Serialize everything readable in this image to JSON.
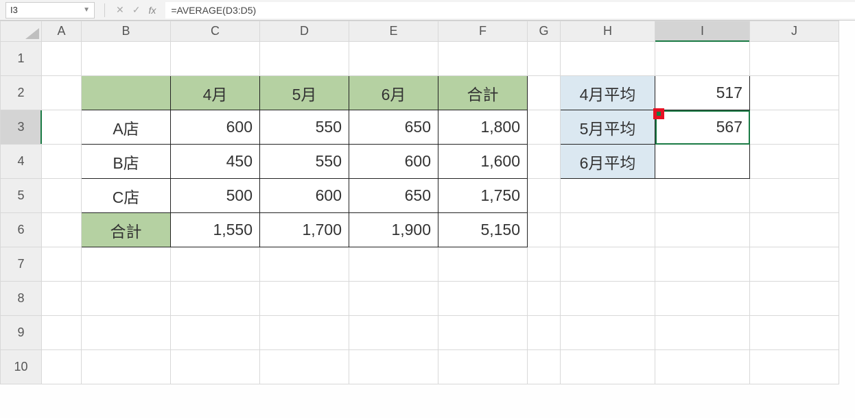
{
  "formula_bar": {
    "name_box": "I3",
    "cancel_icon": "✕",
    "confirm_icon": "✓",
    "fx_label": "fx",
    "formula": "=AVERAGE(D3:D5)"
  },
  "columns": [
    "A",
    "B",
    "C",
    "D",
    "E",
    "F",
    "G",
    "H",
    "I",
    "J"
  ],
  "rows": [
    "1",
    "2",
    "3",
    "4",
    "5",
    "6",
    "7",
    "8",
    "9",
    "10"
  ],
  "active_cell": "I3",
  "table1": {
    "headers": [
      "",
      "4月",
      "5月",
      "6月",
      "合計"
    ],
    "rows": [
      {
        "label": "A店",
        "vals": [
          "600",
          "550",
          "650",
          "1,800"
        ]
      },
      {
        "label": "B店",
        "vals": [
          "450",
          "550",
          "600",
          "1,600"
        ]
      },
      {
        "label": "C店",
        "vals": [
          "500",
          "600",
          "650",
          "1,750"
        ]
      },
      {
        "label": "合計",
        "vals": [
          "1,550",
          "1,700",
          "1,900",
          "5,150"
        ]
      }
    ]
  },
  "table2": {
    "rows": [
      {
        "label": "4月平均",
        "val": "517"
      },
      {
        "label": "5月平均",
        "val": "567"
      },
      {
        "label": "6月平均",
        "val": ""
      }
    ]
  }
}
